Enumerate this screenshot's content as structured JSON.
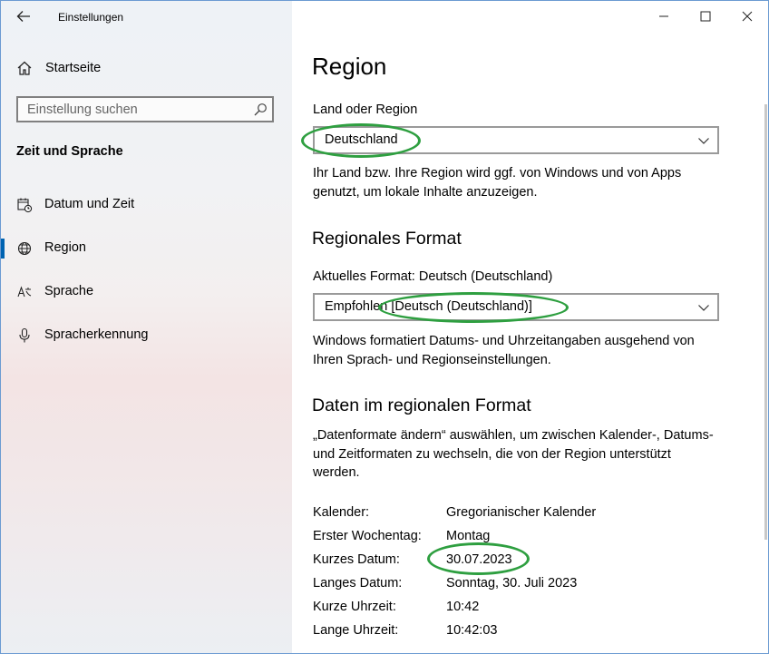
{
  "window": {
    "app_title": "Einstellungen",
    "caption_icons": [
      "minimize-icon",
      "maximize-icon",
      "close-icon"
    ]
  },
  "sidebar": {
    "home_label": "Startseite",
    "search_placeholder": "Einstellung suchen",
    "section_title": "Zeit und Sprache",
    "items": [
      {
        "label": "Datum und Zeit",
        "icon": "calendar-clock-icon",
        "active": false
      },
      {
        "label": "Region",
        "icon": "globe-icon",
        "active": true
      },
      {
        "label": "Sprache",
        "icon": "language-icon",
        "active": false
      },
      {
        "label": "Spracherkennung",
        "icon": "microphone-icon",
        "active": false
      }
    ]
  },
  "content": {
    "title": "Region",
    "country_label": "Land oder Region",
    "country_value": "Deutschland",
    "country_desc": "Ihr Land bzw. Ihre Region wird ggf. von Windows und von Apps genutzt, um lokale Inhalte anzuzeigen.",
    "format_heading": "Regionales Format",
    "current_format_label": "Aktuelles Format: Deutsch (Deutschland)",
    "format_value": "Empfohlen [Deutsch (Deutschland)]",
    "format_desc": "Windows formatiert Datums- und Uhrzeitangaben ausgehend von Ihren Sprach- und Regionseinstellungen.",
    "data_heading": "Daten im regionalen Format",
    "data_desc": "„Datenformate ändern“ auswählen, um zwischen Kalender-, Datums- und Zeitformaten zu wechseln, die von der Region unterstützt werden.",
    "rows": [
      {
        "label": "Kalender:",
        "value": "Gregorianischer Kalender"
      },
      {
        "label": "Erster Wochentag:",
        "value": "Montag"
      },
      {
        "label": "Kurzes Datum:",
        "value": "30.07.2023"
      },
      {
        "label": "Langes Datum:",
        "value": "Sonntag, 30. Juli 2023"
      },
      {
        "label": "Kurze Uhrzeit:",
        "value": "10:42"
      },
      {
        "label": "Lange Uhrzeit:",
        "value": "10:42:03"
      }
    ]
  },
  "colors": {
    "accent": "#0063b1",
    "annotation": "#2e9f40",
    "window_border": "#6b9bd2"
  }
}
